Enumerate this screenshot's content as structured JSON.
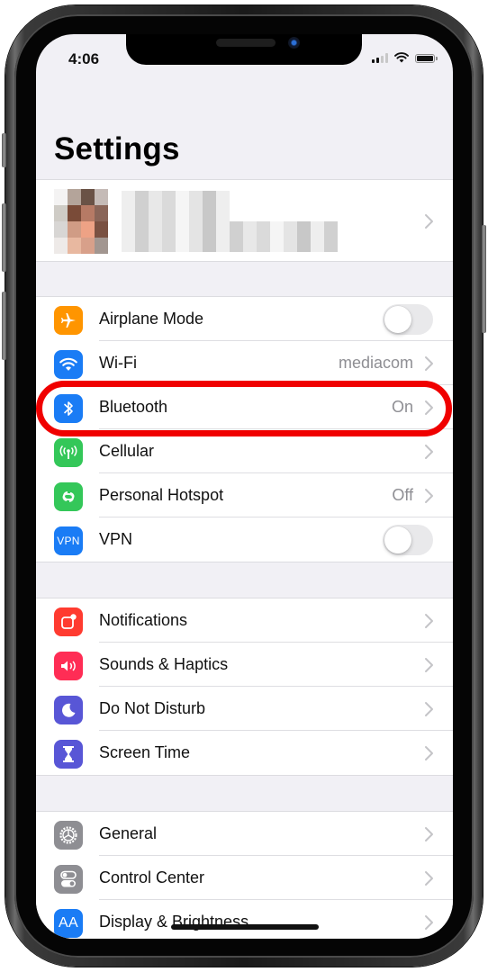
{
  "status_bar": {
    "time": "4:06",
    "signal_bars": 2,
    "signal_bars_total": 4,
    "wifi_icon": "wifi-icon",
    "battery_icon": "battery-icon"
  },
  "header": {
    "title": "Settings"
  },
  "profile": {
    "avatar_icon": "avatar-pixelated",
    "name_redacted": true
  },
  "groups": [
    {
      "rows": [
        {
          "label": "Airplane Mode",
          "icon": "airplane-icon",
          "icon_color": "#ff9500",
          "control": "toggle",
          "toggle_on": false
        },
        {
          "label": "Wi-Fi",
          "icon": "wifi-icon",
          "icon_color": "#1a7cf5",
          "value": "mediacom",
          "control": "chevron"
        },
        {
          "label": "Bluetooth",
          "icon": "bluetooth-icon",
          "icon_color": "#1a7cf5",
          "value": "On",
          "control": "chevron",
          "highlighted": true
        },
        {
          "label": "Cellular",
          "icon": "cellular-icon",
          "icon_color": "#34c759",
          "value": "",
          "control": "chevron"
        },
        {
          "label": "Personal Hotspot",
          "icon": "hotspot-icon",
          "icon_color": "#34c759",
          "value": "Off",
          "control": "chevron"
        },
        {
          "label": "VPN",
          "icon": "vpn-icon",
          "icon_text": "VPN",
          "icon_color": "#1a7cf5",
          "control": "toggle",
          "toggle_on": false
        }
      ]
    },
    {
      "rows": [
        {
          "label": "Notifications",
          "icon": "notifications-icon",
          "icon_color": "#ff3b30",
          "control": "chevron"
        },
        {
          "label": "Sounds & Haptics",
          "icon": "sound-icon",
          "icon_color": "#ff2d55",
          "control": "chevron"
        },
        {
          "label": "Do Not Disturb",
          "icon": "moon-icon",
          "icon_color": "#5856d6",
          "control": "chevron"
        },
        {
          "label": "Screen Time",
          "icon": "hourglass-icon",
          "icon_color": "#5856d6",
          "control": "chevron"
        }
      ]
    },
    {
      "rows": [
        {
          "label": "General",
          "icon": "gear-icon",
          "icon_color": "#8e8e93",
          "control": "chevron"
        },
        {
          "label": "Control Center",
          "icon": "control-center-icon",
          "icon_color": "#8e8e93",
          "control": "chevron"
        },
        {
          "label": "Display & Brightness",
          "icon": "display-icon",
          "icon_text": "AA",
          "icon_color": "#1a7cf5",
          "control": "chevron"
        }
      ]
    }
  ],
  "annotation": {
    "highlight_color": "#f00000",
    "target": "Bluetooth"
  },
  "colors": {
    "background": "#f1f0f5",
    "chevron": "#c4c4c7",
    "secondary_text": "#8e8e93"
  }
}
